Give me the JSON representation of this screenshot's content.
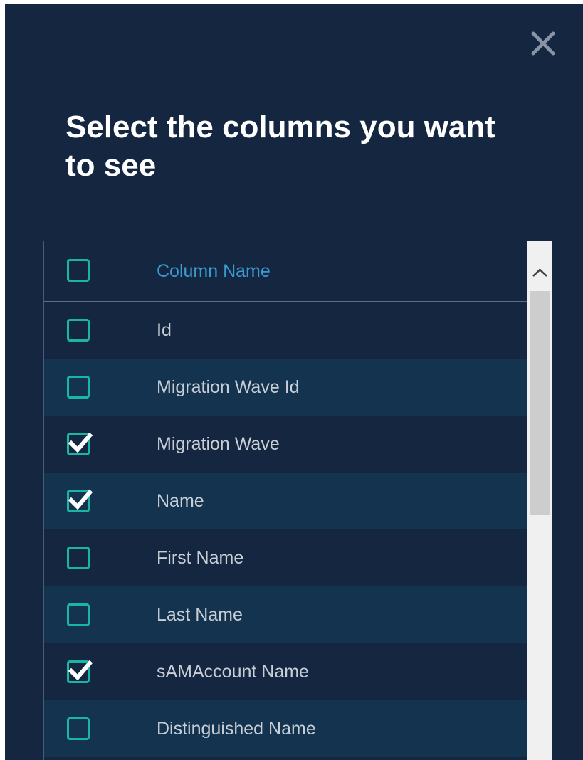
{
  "dialog": {
    "title": "Select the columns you want to see",
    "close_icon": "close-icon"
  },
  "table": {
    "header": {
      "label": "Column Name",
      "checked": false
    },
    "rows": [
      {
        "label": "Id",
        "checked": false
      },
      {
        "label": "Migration Wave Id",
        "checked": false
      },
      {
        "label": "Migration Wave",
        "checked": true
      },
      {
        "label": "Name",
        "checked": true
      },
      {
        "label": "First Name",
        "checked": false
      },
      {
        "label": "Last Name",
        "checked": false
      },
      {
        "label": "sAMAccount Name",
        "checked": true
      },
      {
        "label": "Distinguished Name",
        "checked": false
      }
    ]
  },
  "colors": {
    "background": "#142640",
    "row_alt": "#13334e",
    "accent": "#1ab6a4",
    "header_text": "#3a9bd0",
    "row_text": "#c8ced6"
  }
}
